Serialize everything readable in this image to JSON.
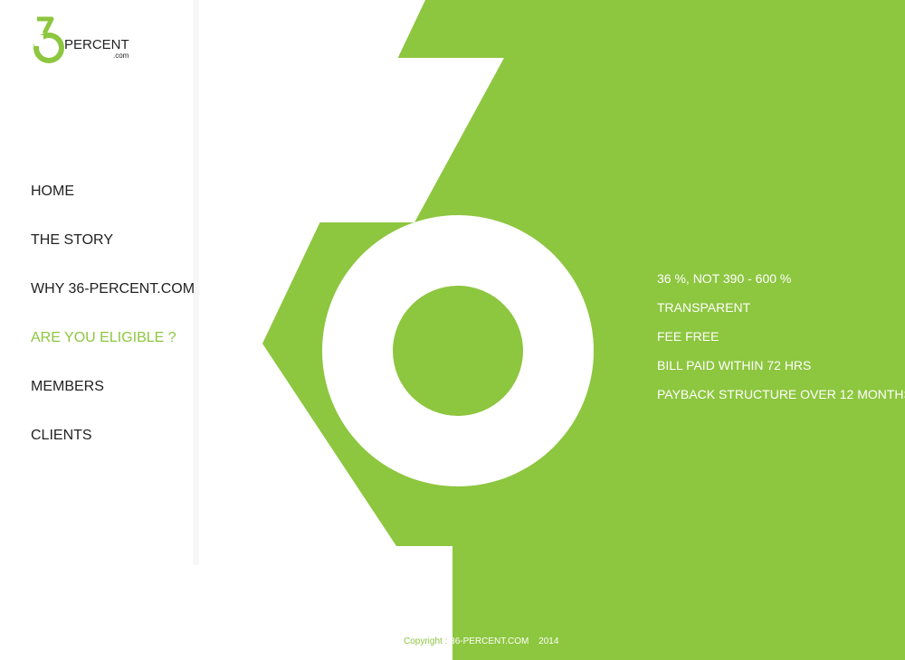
{
  "brand": {
    "digit": "3",
    "name": "PERCENT",
    "domain": ".com",
    "accent_color": "#8dc63f"
  },
  "nav": {
    "items": [
      {
        "label": "HOME",
        "active": false
      },
      {
        "label": "THE STORY",
        "active": false
      },
      {
        "label": "WHY 36-PERCENT.COM",
        "active": false
      },
      {
        "label": "ARE YOU ELIGIBLE ?",
        "active": true
      },
      {
        "label": "MEMBERS",
        "active": false
      },
      {
        "label": "CLIENTS",
        "active": false
      }
    ]
  },
  "features": [
    "36 %, NOT 390 - 600 %",
    "TRANSPARENT",
    "FEE FREE",
    "BILL PAID WITHIN 72 HRS",
    "PAYBACK STRUCTURE OVER 12 MONTHS"
  ],
  "footer": {
    "label": "Copyright :",
    "owner": "36-PERCENT.COM",
    "year": "2014"
  }
}
